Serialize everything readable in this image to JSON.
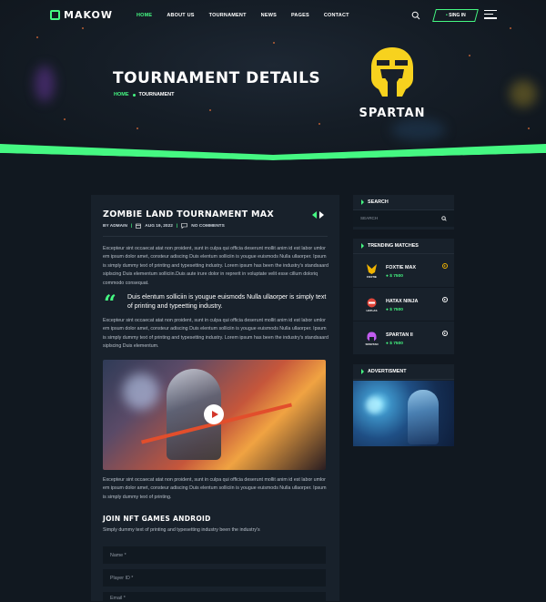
{
  "brand": {
    "name": "MAKOW"
  },
  "nav": {
    "items": [
      {
        "label": "HOME",
        "active": true
      },
      {
        "label": "ABOUT US",
        "active": false
      },
      {
        "label": "TOURNAMENT",
        "active": false
      },
      {
        "label": "NEWS",
        "active": false
      },
      {
        "label": "PAGES",
        "active": false
      },
      {
        "label": "CONTACT",
        "active": false
      }
    ],
    "signin_label": "SING IN"
  },
  "hero": {
    "title": "TOURNAMENT DETAILS",
    "breadcrumb": {
      "home": "HOME",
      "current": "TOURNAMENT"
    },
    "badge_name": "SPARTAN"
  },
  "post": {
    "title": "ZOMBIE LAND TOURNAMENT MAX",
    "meta": {
      "author": "BY ADMAIN",
      "date": "AUG 19, 2022",
      "comments": "NO COMMENTS"
    },
    "para1": "Excepteur sint occaecat atat non proident, sunt in culpa qui officia deserunt mollit anim id est labor umlor em ipsum dolor amet, consteur adiscing Duis elentum solliciin is yougue euismods Nulla ullaorper. Ipsum is simply dummy text of printing and typesetting industry. Lorem ipsum has been the industry's standsaard siplscing Duis elementum solliciin.Duis aute irure dolor in reprerit in voluptate velit esse cillum doloriq commodo consequat.",
    "quote": "Duis elentum solliciin is yougue euismods Nulla ullaorper is simply text of printing and typeetting industry.",
    "para2": "Excepteur sint occaecat atat non proident, sunt in culpa qui officia deserunt mollit anim id est labor umlor em ipsum dolor amet, consteur adiscing Duis elentum solliciin is yougue euismods Nulla ullaorper. Ipsum is simply dummy text of printing and typesetting industry. Lorem ipsum has been the industry's standsaard siplscing Duis elementum.",
    "para3": "Excepteur sint occaecat atat non proident, sunt in culpa qui officia deserunt mollit anim id est labor umlor em ipsum dolor amet, consteur adiscing Duis elentum solliciin is yougue euismods Nulla ullaorper. Ipsum is simply dummy text of printing.",
    "form_title": "JOIN NFT GAMES ANDROID",
    "form_text": "Simply dummy text of printing and typesetting industry been the industry's",
    "fields": [
      "Name *",
      "Player ID *",
      "Email *"
    ]
  },
  "sidebar": {
    "search": {
      "title": "SEARCH",
      "placeholder": "SEARCH"
    },
    "trending": {
      "title": "TRENDING MATCHES",
      "matches": [
        {
          "name": "FOXTIE MAX",
          "price": "$ 7500",
          "thumb_label": "FOXTIE"
        },
        {
          "name": "HATAX NINJA",
          "price": "$ 7500",
          "thumb_label": "HATLAS"
        },
        {
          "name": "SPARTAN II",
          "price": "$ 7500",
          "thumb_label": "SPARTAN"
        }
      ]
    },
    "ad": {
      "title": "ADVERTISMENT"
    }
  },
  "colors": {
    "accent": "#45f882",
    "bg": "#111820",
    "panel": "#18212b",
    "gold": "#f0b300"
  }
}
